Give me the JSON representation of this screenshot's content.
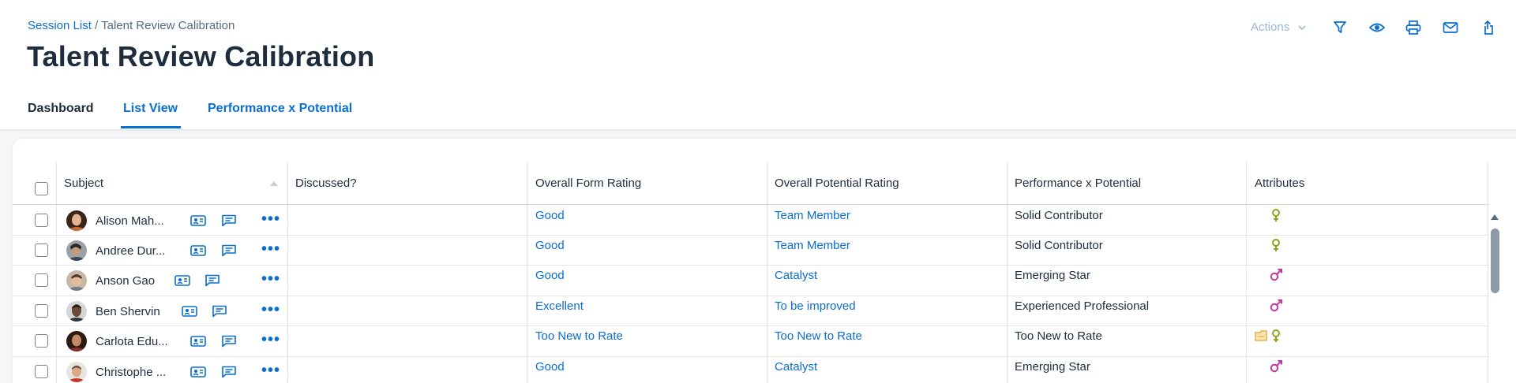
{
  "breadcrumb": {
    "link": "Session List",
    "separator": " / ",
    "current": "Talent Review Calibration"
  },
  "page_title": "Talent Review Calibration",
  "toolbar": {
    "actions_label": "Actions",
    "icons": [
      "filter-icon",
      "eye-icon",
      "print-icon",
      "mail-icon",
      "export-icon"
    ]
  },
  "tabs": [
    {
      "label": "Dashboard",
      "selected": false
    },
    {
      "label": "List View",
      "selected": true
    },
    {
      "label": "Performance x Potential",
      "selected": false
    }
  ],
  "table": {
    "columns": [
      "Subject",
      "Discussed?",
      "Overall Form Rating",
      "Overall Potential Rating",
      "Performance x Potential",
      "Attributes"
    ],
    "rows": [
      {
        "name": "Alison Mah...",
        "discussed": "",
        "form_rating": "Good",
        "potential_rating": "Team Member",
        "perf_potential": "Solid Contributor",
        "attributes": [
          "female-icon"
        ]
      },
      {
        "name": "Andree Dur...",
        "discussed": "",
        "form_rating": "Good",
        "potential_rating": "Team Member",
        "perf_potential": "Solid Contributor",
        "attributes": [
          "female-icon"
        ]
      },
      {
        "name": "Anson Gao",
        "discussed": "",
        "form_rating": "Good",
        "potential_rating": "Catalyst",
        "perf_potential": "Emerging Star",
        "attributes": [
          "male-icon"
        ]
      },
      {
        "name": "Ben Shervin",
        "discussed": "",
        "form_rating": "Excellent",
        "potential_rating": "To be improved",
        "perf_potential": "Experienced Professional",
        "attributes": [
          "male-icon"
        ]
      },
      {
        "name": "Carlota Edu...",
        "discussed": "",
        "form_rating": "Too New to Rate",
        "potential_rating": "Too New to Rate",
        "perf_potential": "Too New to Rate",
        "attributes": [
          "new-hire-icon",
          "female-icon"
        ]
      },
      {
        "name": "Christophe ...",
        "discussed": "",
        "form_rating": "Good",
        "potential_rating": "Catalyst",
        "perf_potential": "Emerging Star",
        "attributes": [
          "male-icon"
        ]
      }
    ]
  },
  "colors": {
    "accent": "#0a6ed1",
    "female_attr": "#8fa31e",
    "male_attr": "#c0399f",
    "new_hire_attr": "#e8b04a",
    "title": "#1d2d3e"
  }
}
